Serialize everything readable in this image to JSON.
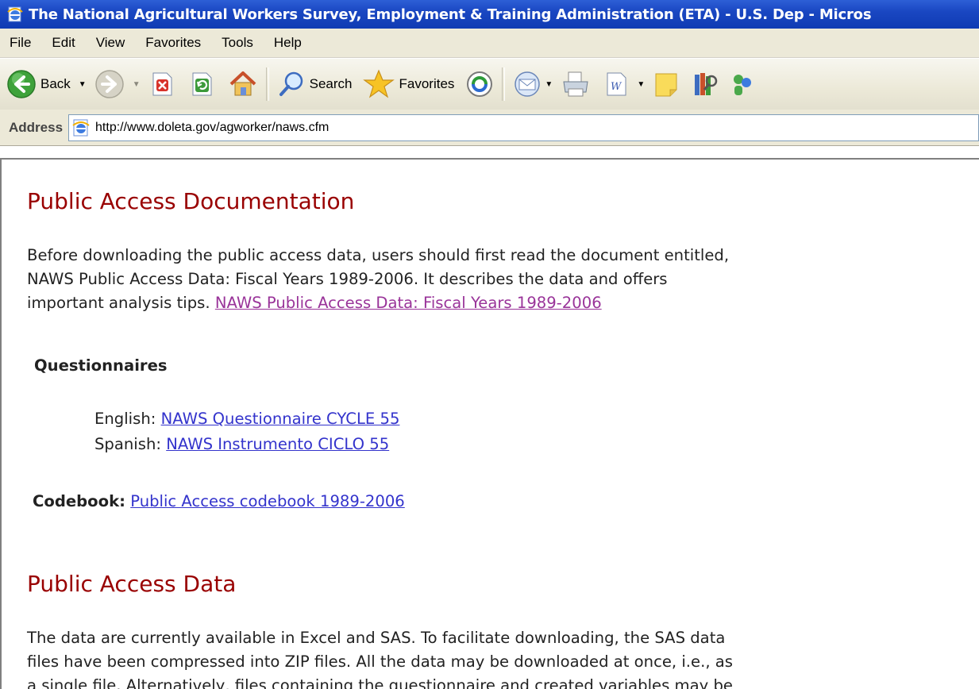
{
  "window": {
    "title": "The National Agricultural Workers Survey, Employment & Training Administration (ETA) - U.S. Dep - Micros"
  },
  "menu": {
    "items": [
      "File",
      "Edit",
      "View",
      "Favorites",
      "Tools",
      "Help"
    ]
  },
  "toolbar": {
    "back_label": "Back",
    "search_label": "Search",
    "favorites_label": "Favorites",
    "icons": [
      "back-icon",
      "forward-icon",
      "stop-icon",
      "refresh-icon",
      "home-icon",
      "search-icon",
      "favorites-star-icon",
      "media-icon",
      "mail-icon",
      "print-icon",
      "word-icon",
      "notes-icon",
      "research-icon",
      "messenger-icon"
    ]
  },
  "address": {
    "label": "Address",
    "url": "http://www.doleta.gov/agworker/naws.cfm"
  },
  "page": {
    "section1_heading": "Public Access Documentation",
    "intro_lines": [
      "Before downloading the public access data, users should first read the document entitled,",
      "NAWS Public Access Data: Fiscal Years 1989-2006. It describes the data and offers",
      "important analysis tips. "
    ],
    "intro_link": "NAWS Public Access Data: Fiscal Years 1989-2006",
    "questionnaires_heading": "Questionnaires",
    "english_label": "English: ",
    "english_link": "NAWS Questionnaire CYCLE 55",
    "spanish_label": "Spanish: ",
    "spanish_link": "NAWS Instrumento CICLO 55",
    "codebook_label": "Codebook:",
    "codebook_link": "Public Access codebook 1989-2006",
    "section2_heading": "Public Access Data",
    "data_lines": [
      "The data are currently available in Excel and SAS. To facilitate downloading, the SAS data",
      "files have been compressed into ZIP files. All the data may be downloaded at once, i.e., as",
      "a single file. Alternatively, files containing the questionnaire and created variables may be"
    ]
  },
  "colors": {
    "heading_red": "#990000",
    "link_blue": "#3333cc",
    "link_visited": "#993399",
    "titlebar_blue": "#1a47c2",
    "chrome_beige": "#ece9d8"
  }
}
